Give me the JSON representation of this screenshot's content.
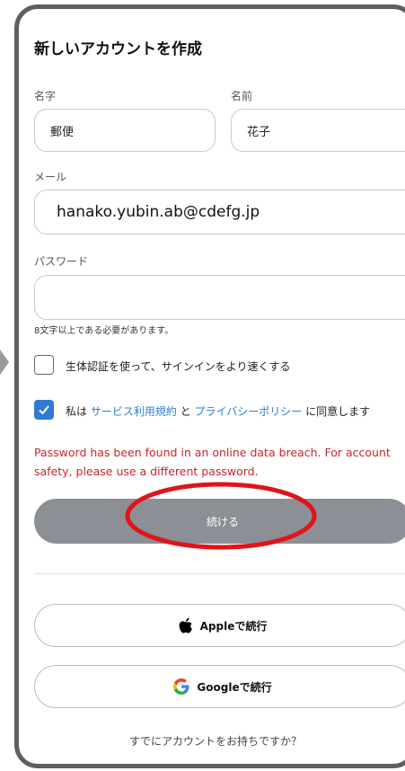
{
  "header": {
    "title": "新しいアカウントを作成"
  },
  "form": {
    "last_name_label": "名字",
    "last_name_value": "郵便",
    "first_name_label": "名前",
    "first_name_value": "花子",
    "email_label": "メール",
    "email_value": "hanako.yubin.ab@cdefg.jp",
    "password_label": "パスワード",
    "password_value": "",
    "password_hint": "8文字以上である必要があります。",
    "biometric_label": "生体認証を使って、サインインをより速くする",
    "biometric_checked": false,
    "terms_prefix": "私は",
    "terms_link": "サービス利用規約",
    "terms_and": "と",
    "privacy_link": "プライバシーポリシー",
    "terms_suffix": "に同意します",
    "terms_checked": true,
    "error_message": "Password has been found in an online data breach. For account safety, please use a different password.",
    "continue_label": "続ける"
  },
  "social": {
    "apple_label": "Appleで続行",
    "google_label": "Googleで続行"
  },
  "footer": {
    "signin_prompt": "すでにアカウントをお持ちですか？"
  },
  "colors": {
    "accent": "#2f7bd3",
    "error": "#c9252c",
    "button_disabled": "#8d8f96",
    "annotation": "#e0141b"
  },
  "icons": [
    "apple-logo-icon",
    "google-logo-icon",
    "checkmark-icon"
  ]
}
